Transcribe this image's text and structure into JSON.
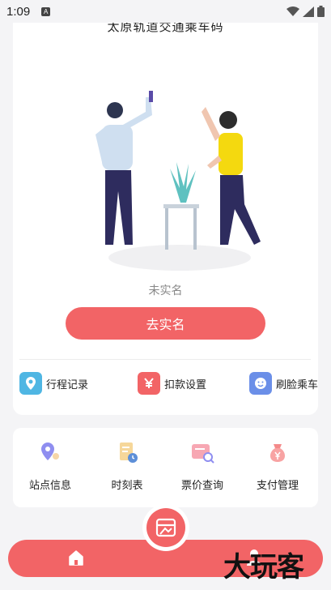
{
  "status_bar": {
    "time": "1:09",
    "badge": "A"
  },
  "card": {
    "cut_title": "太原轨道交通乘车码",
    "name_status": "未实名",
    "go_button": "去实名"
  },
  "quick_links": [
    {
      "label": "行程记录",
      "icon": "location-pin-icon",
      "color": "#4fb6e3"
    },
    {
      "label": "扣款设置",
      "icon": "yen-icon",
      "color": "#f26466"
    },
    {
      "label": "刷脸乘车",
      "icon": "face-icon",
      "color": "#6b8fe8"
    }
  ],
  "services": [
    {
      "label": "站点信息",
      "icon": "station-pin-icon"
    },
    {
      "label": "时刻表",
      "icon": "timetable-icon"
    },
    {
      "label": "票价查询",
      "icon": "ticket-search-icon"
    },
    {
      "label": "支付管理",
      "icon": "payment-bag-icon"
    }
  ],
  "nav": {
    "home": "home-icon",
    "center": "ride-code-icon",
    "profile": "profile-icon"
  },
  "watermark": "大玩客",
  "colors": {
    "accent": "#f26466",
    "background": "#f4f4f6"
  }
}
